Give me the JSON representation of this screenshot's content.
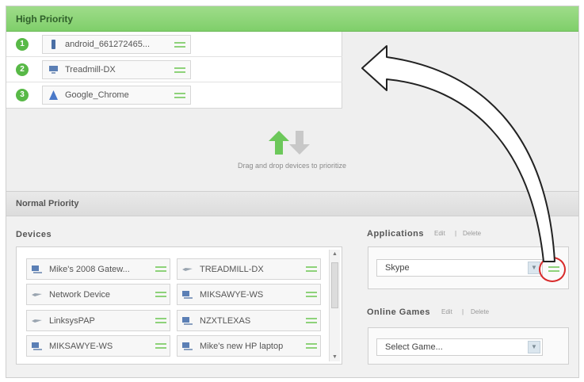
{
  "high_priority": {
    "title": "High Priority",
    "devices": [
      {
        "rank": "1",
        "name": "android_661272465...",
        "icon": "phone-icon"
      },
      {
        "rank": "2",
        "name": "Treadmill-DX",
        "icon": "computer-icon"
      },
      {
        "rank": "3",
        "name": "Google_Chrome",
        "icon": "chrome-icon"
      }
    ]
  },
  "drop_zone": {
    "hint": "Drag and drop devices to prioritize"
  },
  "normal_priority": {
    "title": "Normal Priority",
    "devices_label": "Devices",
    "devices": [
      {
        "name": "Mike's 2008 Gatew...",
        "icon": "computer-icon"
      },
      {
        "name": "TREADMILL-DX",
        "icon": "network-icon"
      },
      {
        "name": "Network Device",
        "icon": "network-icon"
      },
      {
        "name": "MIKSAWYE-WS",
        "icon": "computer-icon"
      },
      {
        "name": "LinksysPAP",
        "icon": "network-icon"
      },
      {
        "name": "NZXTLEXAS",
        "icon": "computer-icon"
      },
      {
        "name": "MIKSAWYE-WS",
        "icon": "computer-icon"
      },
      {
        "name": "Mike's new HP laptop",
        "icon": "computer-icon"
      }
    ],
    "applications": {
      "label": "Applications",
      "edit": "Edit",
      "separator": "|",
      "delete": "Delete",
      "selected": "Skype"
    },
    "online_games": {
      "label": "Online Games",
      "edit": "Edit",
      "separator": "|",
      "delete": "Delete",
      "selected": "Select Game..."
    }
  },
  "colors": {
    "accent_green": "#7fcf6a",
    "highlight_red": "#d82a2a"
  }
}
